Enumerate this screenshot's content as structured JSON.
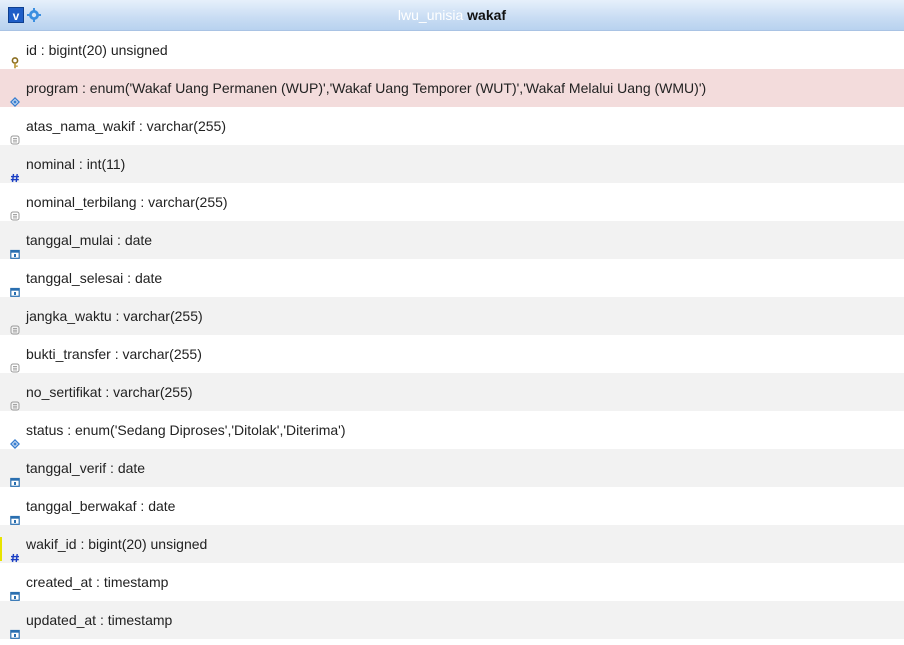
{
  "header": {
    "toggle_label": "v",
    "db_name": "lwu_unisia",
    "table_name": "wakaf"
  },
  "fields": [
    {
      "text": "id : bigint(20) unsigned",
      "icon": "key-icon"
    },
    {
      "text": "program : enum('Wakaf Uang Permanen (WUP)','Wakaf Uang Temporer (WUT)','Wakaf Melalui Uang (WMU)')",
      "icon": "enum-icon"
    },
    {
      "text": "atas_nama_wakif : varchar(255)",
      "icon": "text-icon"
    },
    {
      "text": "nominal : int(11)",
      "icon": "number-icon"
    },
    {
      "text": "nominal_terbilang : varchar(255)",
      "icon": "text-icon"
    },
    {
      "text": "tanggal_mulai : date",
      "icon": "date-icon"
    },
    {
      "text": "tanggal_selesai : date",
      "icon": "date-icon"
    },
    {
      "text": "jangka_waktu : varchar(255)",
      "icon": "text-icon"
    },
    {
      "text": "bukti_transfer : varchar(255)",
      "icon": "text-icon"
    },
    {
      "text": "no_sertifikat : varchar(255)",
      "icon": "text-icon"
    },
    {
      "text": "status : enum('Sedang Diproses','Ditolak','Diterima')",
      "icon": "enum-icon"
    },
    {
      "text": "tanggal_verif : date",
      "icon": "date-icon"
    },
    {
      "text": "tanggal_berwakaf : date",
      "icon": "date-icon"
    },
    {
      "text": "wakif_id : bigint(20) unsigned",
      "icon": "number-icon"
    },
    {
      "text": "created_at : timestamp",
      "icon": "date-icon"
    },
    {
      "text": "updated_at : timestamp",
      "icon": "date-icon"
    }
  ],
  "colors": {
    "header_bg": "#c8dcf3",
    "highlight_row": "#f3dcdc",
    "toggle_bg": "#1f5ec7",
    "number_icon": "#1a3fc4",
    "enum_icon": "#3a7fd0"
  }
}
